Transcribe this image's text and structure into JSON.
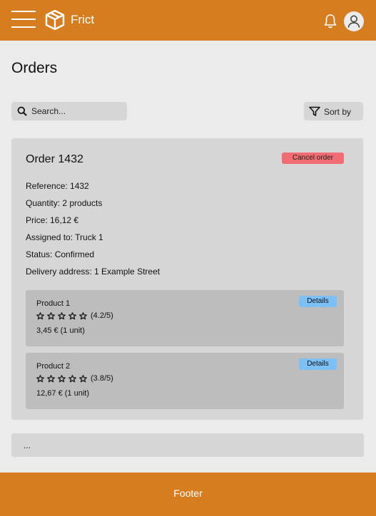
{
  "header": {
    "brand": "Frict",
    "colors": {
      "primary": "#d57d1f",
      "background": "#ebebeb"
    },
    "icons": [
      "hamburger-menu-icon",
      "box-logo-icon",
      "bell-icon",
      "user-icon"
    ]
  },
  "page": {
    "title": "Orders"
  },
  "toolbar": {
    "search_placeholder": "Search...",
    "sort_label": "Sort by"
  },
  "order": {
    "title": "Order 1432",
    "cancel_label": "Cancel order",
    "details": [
      "Reference: 1432",
      "Quantity: 2 products",
      "Price: 16,12 €",
      "Assigned to: Truck 1",
      "Status: Confirmed",
      "Delivery address: 1 Example Street"
    ],
    "products": [
      {
        "name": "Product 1",
        "rating": "(4.2/5)",
        "price": "3,45 € (1 unit)",
        "details_label": "Details"
      },
      {
        "name": "Product 2",
        "rating": "(3.8/5)",
        "price": "12,67 € (1 unit)",
        "details_label": "Details"
      }
    ]
  },
  "more": {
    "label": "..."
  },
  "footer": {
    "label": "Footer"
  }
}
